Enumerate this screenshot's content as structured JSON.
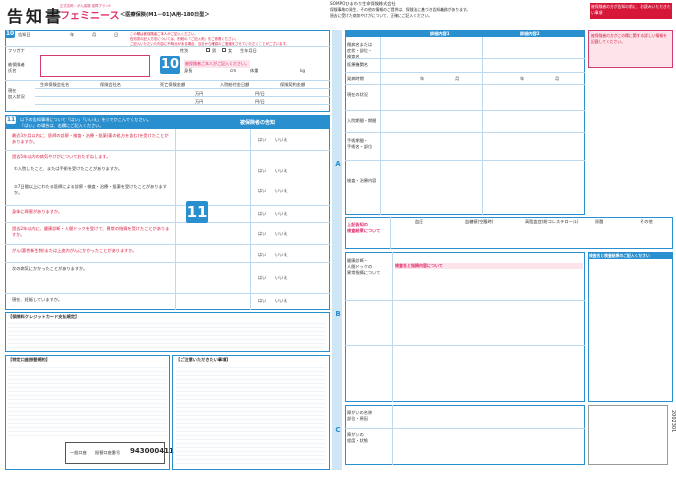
{
  "header": {
    "title": "告知書",
    "product_small": "正式名称：がん保険 保障プランII",
    "product": "フェミニース",
    "form_kind": "＜医療保険(M1－01)A用-180日型＞",
    "company": "SOMPOひまわり生命保険株式会社",
    "notice_1": "この欄は被保険者ご本人がご記入ください。",
    "notice_2": "告知書の記入方法については、別紙の「ご記入例」をご参照ください。",
    "notice_3": "ご記入いただいた内容に不明点がある場合、当社から確認のご連絡をさせていただくことがございます。",
    "right_note_1": "保険事故の発生、その他の情報のご提供は、保険法に基づき告知義務があります。",
    "right_note_2": "過去に受けた病気やけがについて、正確にご記入ください。",
    "box_title": "被保険者の方が告知の前に、お読みいただきたい事項",
    "box_body": "告知書の記入にあたって"
  },
  "section10": {
    "num": "10",
    "date_label": "告知日",
    "year": "年",
    "month": "月",
    "day": "日",
    "furigana": "フリガナ",
    "name_label": "被保険者\n氏名",
    "sex_label": "性別",
    "male": "男",
    "female": "女",
    "birth_label": "生年月日",
    "height_label": "身長",
    "weight_label": "体重",
    "cm": "cm",
    "kg": "kg",
    "big_number": "10",
    "pink_note": "被保険者ご本人がご記入ください。",
    "existing_label": "現在\n加入状況",
    "col_company": "生命保険会社名",
    "col_type": "保険会社名",
    "col_death": "死亡保険金額",
    "col_hosp": "入院給付金日額",
    "col_sum": "保険契約金額",
    "man_yen": "万円",
    "yen_day": "円/日"
  },
  "section11": {
    "num": "11",
    "intro": "以下の告知事項について「はい」「いいえ」を○でかこんでください。",
    "intro2": "「はい」の場合は、右欄にご記入ください。",
    "right_header": "被保険者の告知",
    "big_number": "11",
    "q1": "最近3か月以内に、医師の診察・検査・治療・投薬(薬の処方を含む)を受けたことがありますか。",
    "q2": "過去5年以内の病気やけがについておたずねします。",
    "q2a": "①入院したこと、または手術を受けたことがありますか。",
    "q2b": "②7日間以上にわたる医師による診察・検査・治療・投薬を受けたことがありますか。",
    "q3": "身体に障害がありますか。",
    "q4": "過去2年以内に、健康診断・人間ドックを受けて、異常の指摘を受けたことがありますか。",
    "q5": "がん(悪性新生物)または上皮内がんにかかったことがありますか。",
    "q6": "次の病気にかかったことがありますか。",
    "q7": "現在、妊娠していますか。",
    "yes": "はい",
    "no": "いいえ",
    "note_label": "告知のご注意"
  },
  "notices": {
    "credit_title": "【保険料クレジットカード支払規定】",
    "important_title": "【特定口座振替規約】",
    "cancel_title": "【ご注意いただきたい事項】",
    "bank_label": "一般口座",
    "bank_no_label": "振替口座番号",
    "bank_no": "943000411"
  },
  "right": {
    "top_note": "SOMPOひまわり生命保険株式会社",
    "col_a": "詳細内容1",
    "col_b": "詳細内容2",
    "pink_box": "被保険者の方がこの欄に関する詳しい情報を記載してください。",
    "rowA_label": "A",
    "rowB_label": "B",
    "rowC_label": "C",
    "r_disease": "傷病名または\n症状・部位・\n検査名",
    "r_doctor": "医療機関名",
    "r_when": "発病時期",
    "r_status": "現在の状況",
    "r_hosp": "入院期間・期間",
    "r_surgery": "手術期間・\n手術名・部位",
    "r_cause": "検査・治療内容",
    "year": "年",
    "month": "月",
    "day": "日",
    "a_exam": "上記告知の\n検査結果について",
    "a_cols": [
      "血圧",
      "血糖値(空腹時)",
      "高脂血症(総コレステロール)",
      "尿酸",
      "その他"
    ],
    "b_title": "健康診断・\n人間ドックの\n異常指摘について",
    "b_sub": "検査名と検査結果のご記入ください",
    "b_sub2": "検査名と指摘内容について",
    "c_label": "障がいの名称\n部位・原因",
    "c_label2": "障がいの\n程度・状態",
    "form_no": "2002301"
  }
}
